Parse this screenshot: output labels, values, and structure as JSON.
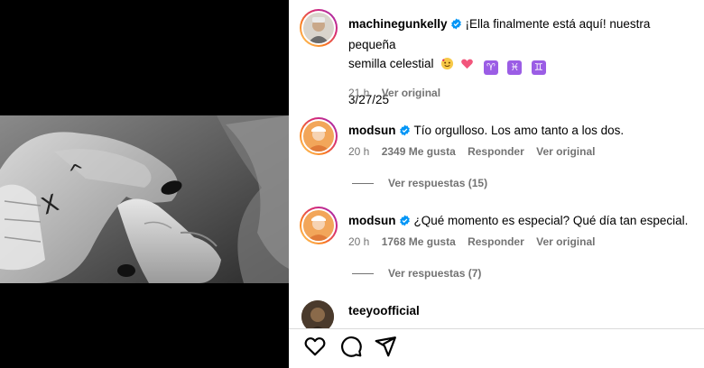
{
  "post": {
    "author": "machinegunkelly",
    "caption": "¡Ella finalmente está aquí! nuestra pequeña semilla celestial",
    "caption_line1": "¡Ella finalmente está aquí! nuestra pequeña",
    "caption_line2": "semilla celestial",
    "date": "3/27/25",
    "time_ago": "21 h",
    "see_original": "Ver original",
    "emojis": [
      "face-with-hearts-emoji",
      "growing-heart-emoji",
      "aries-emoji",
      "pisces-emoji",
      "gemini-emoji"
    ],
    "zodiac_glyphs": [
      "♈",
      "♓",
      "♊"
    ]
  },
  "comments": [
    {
      "user": "modsun",
      "text": "Tío orgulloso. Los amo tanto a los dos.",
      "time_ago": "20 h",
      "likes": "2349 Me gusta",
      "reply": "Responder",
      "see_original": "Ver original",
      "view_replies": "Ver respuestas (15)"
    },
    {
      "user": "modsun",
      "text": "¿Qué momento es especial? Qué día tan especial.",
      "time_ago": "20 h",
      "likes": "1768 Me gusta",
      "reply": "Responder",
      "see_original": "Ver original",
      "view_replies": "Ver respuestas (7)"
    },
    {
      "user": "teeyoofficial"
    }
  ],
  "actions": [
    "heart-icon",
    "comment-icon",
    "share-icon"
  ],
  "colors": {
    "verified": "#0095f6",
    "meta": "#737373",
    "zodiac": "#9b5de5"
  }
}
